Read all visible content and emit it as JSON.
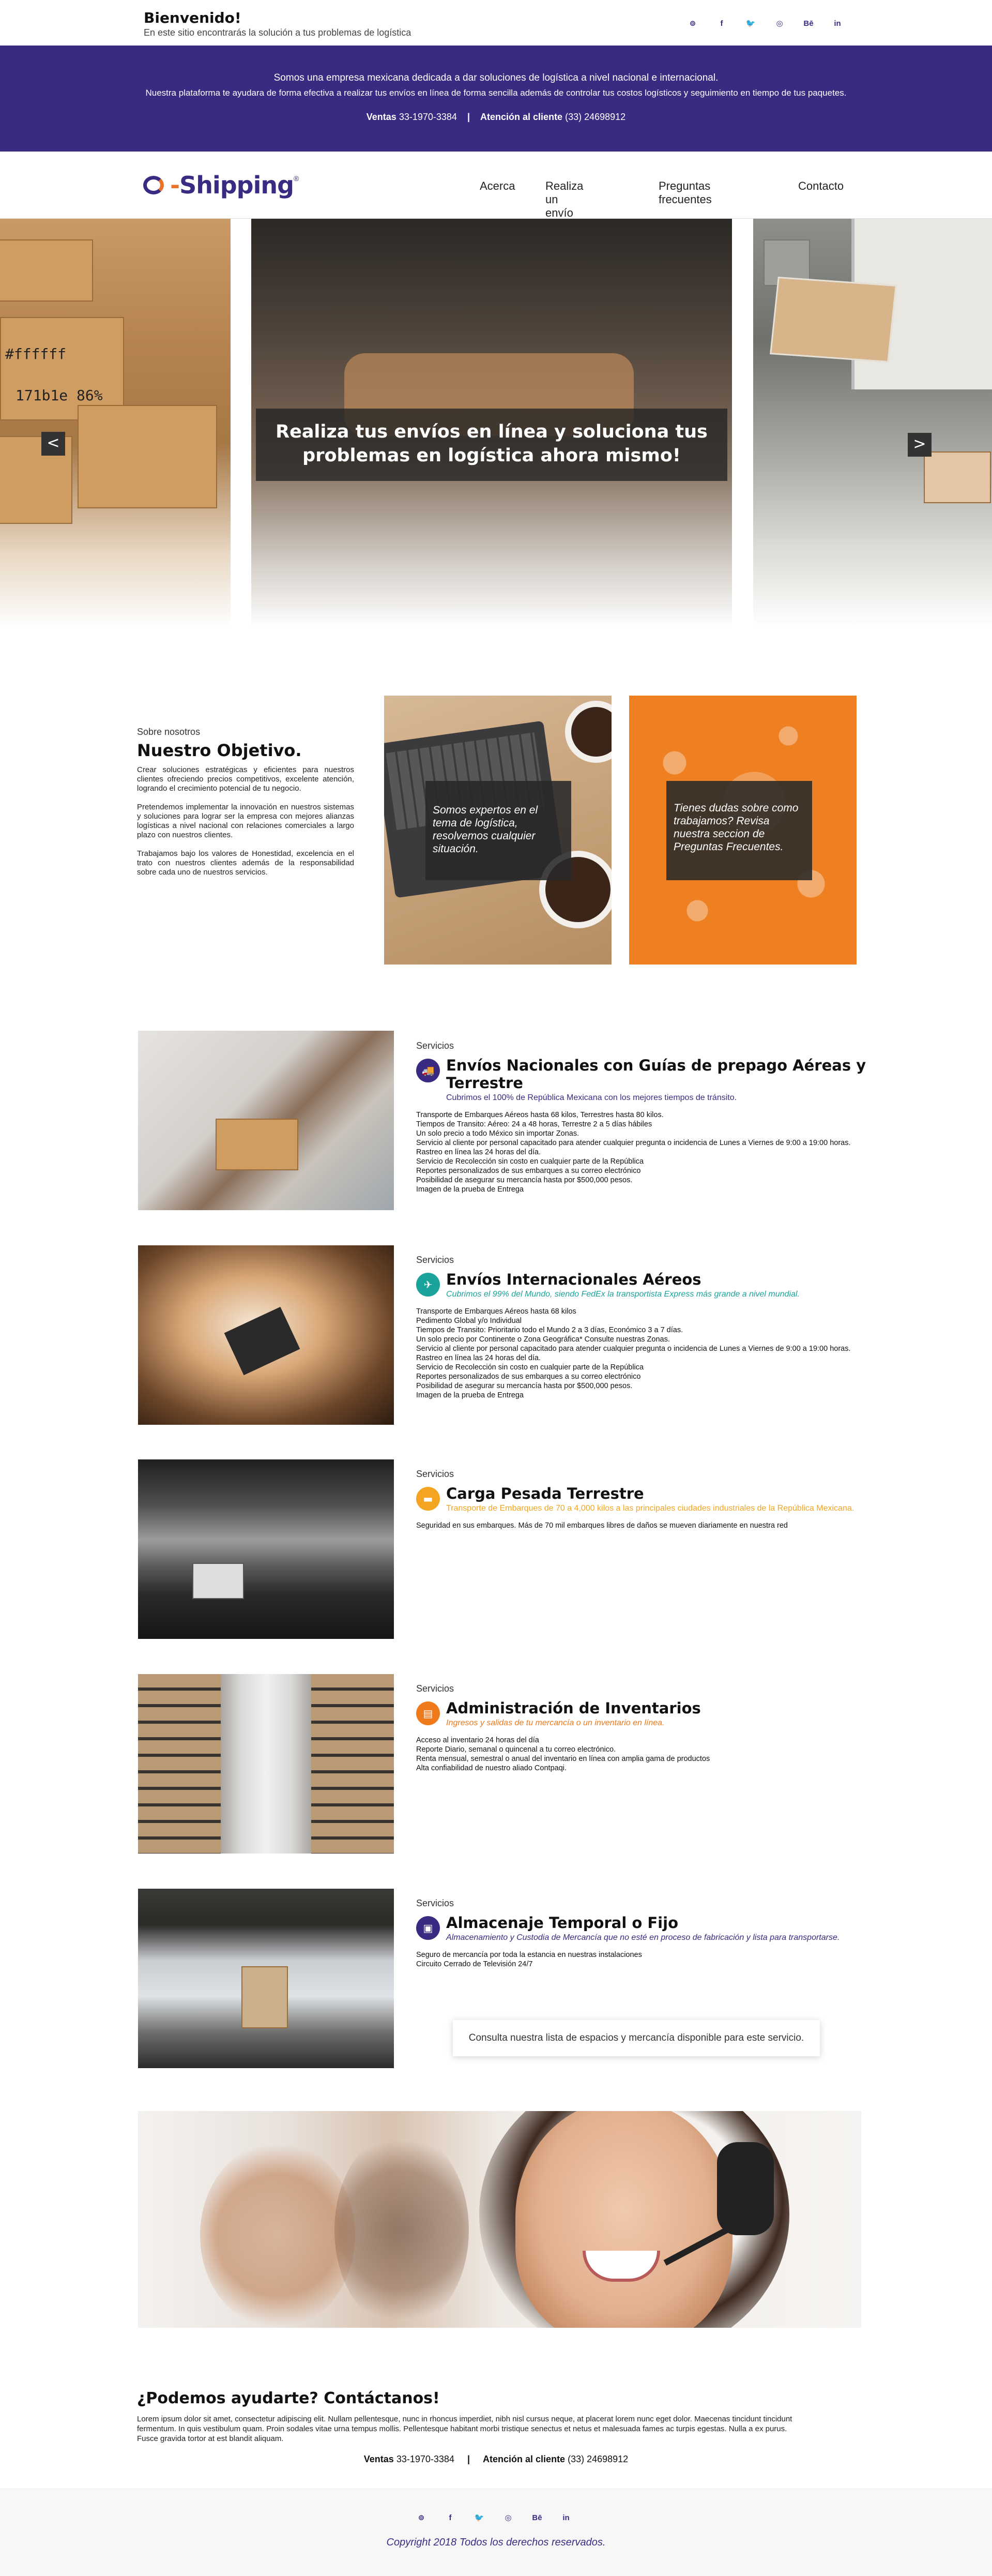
{
  "header": {
    "greeting": "Bienvenido!",
    "tagline": "En este sitio encontrarás la solución a tus problemas de logística"
  },
  "social": [
    "⊚",
    "f",
    "🐦",
    "◎",
    "Bē",
    "in"
  ],
  "social_names": [
    "dribbble-icon",
    "facebook-icon",
    "twitter-icon",
    "instagram-icon",
    "behance-icon",
    "linkedin-icon"
  ],
  "banner": {
    "line1": "Somos una empresa mexicana dedicada a dar soluciones de logística a nivel nacional e internacional.",
    "line2": "Nuestra plataforma te ayudara de forma efectiva a realizar tus envíos en línea de forma sencilla además de controlar tus costos logísticos y seguimiento en tiempo de tus paquetes.",
    "sales_label": "Ventas",
    "sales_phone": "33-1970-3384",
    "separator": "|",
    "support_label": "Atención al cliente",
    "support_phone": "(33) 24698912"
  },
  "brand": {
    "prefix": "e",
    "dash": "-",
    "name": "Shipping",
    "reg": "®"
  },
  "nav": {
    "items": [
      "Acerca",
      "Realiza un envío",
      "Preguntas frecuentes",
      "Contacto"
    ]
  },
  "slider": {
    "caption_line1": "Realiza tus envíos en línea y soluciona tus",
    "caption_line2": "problemas en logística ahora mismo!",
    "prev": "<",
    "next": ">",
    "box_label1": "#ffffff",
    "box_label2": "171b1e 86%"
  },
  "about": {
    "label": "Sobre nosotros",
    "title": "Nuestro Objetivo.",
    "p1": "Crear soluciones estratégicas y eficientes para nuestros clientes ofreciendo precios competitivos, excelente atención, logrando el crecimiento potencial de tu negocio.",
    "p2": "Pretendemos implementar la innovación en nuestros sistemas y soluciones para lograr ser la empresa con mejores alianzas logísticas a nivel nacional con relaciones comerciales a largo plazo con nuestros clientes.",
    "p3": "Trabajamos bajo los valores de Honestidad, excelencia en el trato con nuestros clientes además de la responsabilidad sobre cada uno de nuestros servicios.",
    "card1": "Somos expertos en el tema de logística, resolvemos cualquier situación.",
    "card2": "Tienes dudas sobre como trabajamos? Revisa nuestra seccion de Preguntas Frecuentes."
  },
  "services": [
    {
      "label": "Servicios",
      "title": "Envíos Nacionales con Guías de prepago Aéreas y Terrestre",
      "subtitle": "Cubrimos el 100% de República Mexicana con los mejores tiempos de tránsito.",
      "color": "#3a2a82",
      "icon": "🚚",
      "lines": [
        "Transporte de Embarques Aéreos hasta 68 kilos, Terrestres hasta 80 kilos.",
        "Tiempos de Transito: Aéreo: 24 a 48 horas, Terrestre 2 a 5 días hábiles",
        "Un solo precio a todo México sin importar Zonas.",
        "Servicio al cliente por personal capacitado para atender cualquier pregunta o incidencia de Lunes a Viernes de 9:00 a 19:00 horas.",
        "Rastreo en línea las 24 horas del día.",
        "Servicio de Recolección sin costo en cualquier parte de la República",
        "Reportes personalizados de sus embarques a su correo electrónico",
        "Posibilidad de asegurar su mercancía hasta por $500,000 pesos.",
        "Imagen de la prueba de Entrega"
      ]
    },
    {
      "label": "Servicios",
      "title": "Envíos Internacionales Aéreos",
      "subtitle": "Cubrimos el 99% del Mundo, siendo FedEx la transportista Express más grande a nivel mundial.",
      "color": "#1aa39a",
      "icon": "✈",
      "lines": [
        "Transporte de Embarques Aéreos hasta 68 kilos",
        "Pedimento Global y/o Individual",
        "Tiempos de Transito: Prioritario todo el Mundo 2 a 3 días, Económico 3 a 7 días.",
        "Un solo precio por Continente o Zona Geográfica* Consulte nuestras Zonas.",
        "Servicio al cliente por personal capacitado para atender cualquier pregunta o incidencia de Lunes a Viernes de 9:00 a 19:00 horas.",
        "Rastreo en línea las 24 horas del día.",
        "Servicio de Recolección sin costo en cualquier parte de la República",
        "Reportes personalizados de sus embarques a su correo electrónico",
        "Posibilidad de asegurar su mercancía hasta por $500,000 pesos.",
        "Imagen de la prueba de Entrega"
      ]
    },
    {
      "label": "Servicios",
      "title": "Carga Pesada Terrestre",
      "subtitle": "Transporte de Embarques de 70 a 4,000 kilos a las principales ciudades industriales de la República Mexicana.",
      "color": "#f3a521",
      "icon": "▬",
      "lines": [
        "Seguridad en sus embarques. Más de 70 mil embarques libres de daños se mueven diariamente en nuestra red"
      ]
    },
    {
      "label": "Servicios",
      "title": "Administración de Inventarios",
      "subtitle": "Ingresos y salidas de tu mercancía o un inventario en línea.",
      "color": "#ee7a1c",
      "icon": "▤",
      "lines": [
        "Acceso al inventario 24 horas del día",
        "Reporte Diario, semanal o quincenal a tu correo electrónico.",
        "Renta mensual, semestral o anual del inventario en línea con amplia gama de productos",
        "Alta confiabilidad de nuestro aliado Contpaqi."
      ]
    },
    {
      "label": "Servicios",
      "title": "Almacenaje Temporal o Fijo",
      "subtitle": "Almacenamiento y Custodia de Mercancía que no esté en proceso de fabricación y lista para transportarse.",
      "color": "#3a2a82",
      "icon": "▣",
      "lines": [
        "Seguro de mercancía por toda la estancia en nuestras instalaciones",
        "Circuito Cerrado de Televisión 24/7"
      ]
    }
  ],
  "storage_note": "Consulta nuestra lista de espacios y mercancía disponible para este servicio.",
  "contact": {
    "title": "¿Podemos ayudarte? Contáctanos!",
    "text": "Lorem ipsum dolor sit amet, consectetur adipiscing elit. Nullam pellentesque, nunc in rhoncus imperdiet, nibh nisl cursus neque, at placerat lorem nunc eget dolor. Maecenas tincidunt tincidunt fermentum. In quis vestibulum quam. Proin sodales vitae urna tempus mollis. Pellentesque habitant morbi tristique senectus et netus et malesuada fames ac turpis egestas. Nulla a ex purus. Fusce gravida tortor at est blandit aliquam.",
    "sales_label": "Ventas",
    "sales_phone": "33-1970-3384",
    "separator": "|",
    "support_label": "Atención al cliente",
    "support_phone": "(33) 24698912"
  },
  "footer": {
    "copyright": "Copyright 2018 Todos los derechos reservados."
  }
}
